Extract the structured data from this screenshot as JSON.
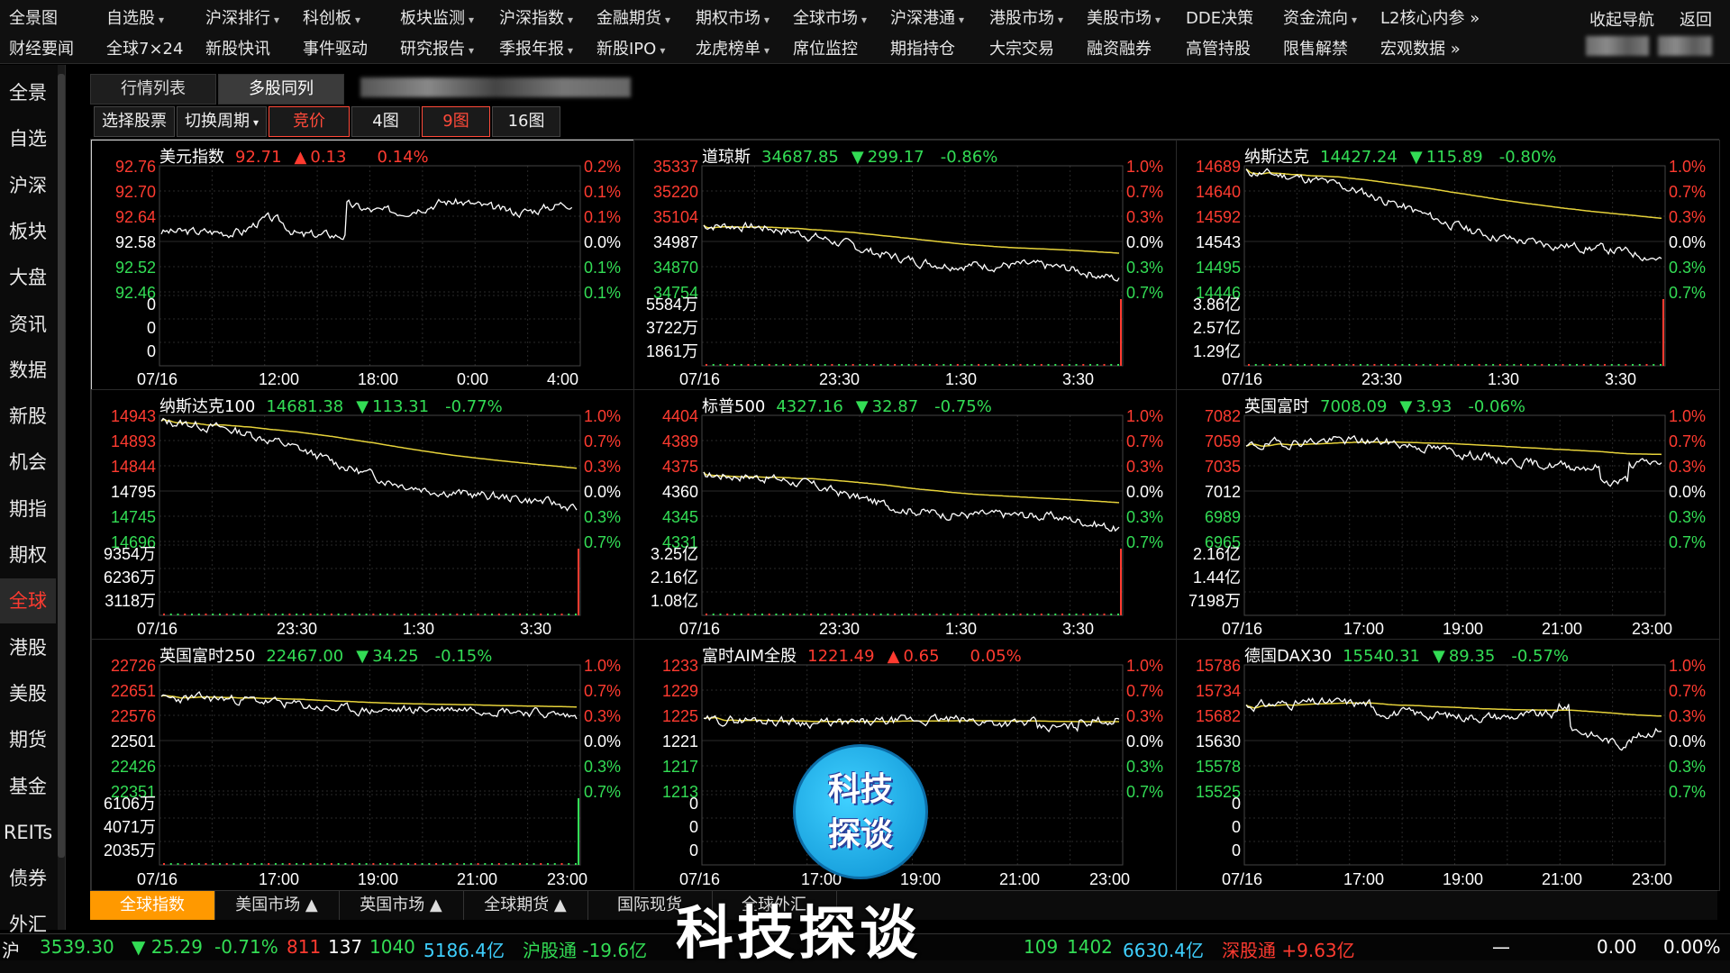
{
  "menu": {
    "row1": [
      {
        "label": "全景图",
        "caret": false
      },
      {
        "label": "自选股",
        "caret": true
      },
      {
        "label": "沪深排行",
        "caret": true
      },
      {
        "label": "科创板",
        "caret": true
      },
      {
        "label": "板块监测",
        "caret": true
      },
      {
        "label": "沪深指数",
        "caret": true
      },
      {
        "label": "金融期货",
        "caret": true
      },
      {
        "label": "期权市场",
        "caret": true
      },
      {
        "label": "全球市场",
        "caret": true
      },
      {
        "label": "沪深港通",
        "caret": true
      },
      {
        "label": "港股市场",
        "caret": true
      },
      {
        "label": "美股市场",
        "caret": true
      },
      {
        "label": "DDE决策",
        "caret": false
      },
      {
        "label": "资金流向",
        "caret": true
      },
      {
        "label": "L2核心内参 »",
        "caret": false
      }
    ],
    "row2": [
      {
        "label": "财经要闻",
        "caret": false
      },
      {
        "label": "全球7×24",
        "caret": false
      },
      {
        "label": "新股快讯",
        "caret": false
      },
      {
        "label": "事件驱动",
        "caret": false
      },
      {
        "label": "研究报告",
        "caret": true
      },
      {
        "label": "季报年报",
        "caret": true
      },
      {
        "label": "新股IPO",
        "caret": true
      },
      {
        "label": "龙虎榜单",
        "caret": true
      },
      {
        "label": "席位监控",
        "caret": false
      },
      {
        "label": "期指持仓",
        "caret": false
      },
      {
        "label": "大宗交易",
        "caret": false
      },
      {
        "label": "融资融券",
        "caret": false
      },
      {
        "label": "高管持股",
        "caret": false
      },
      {
        "label": "限售解禁",
        "caret": false
      },
      {
        "label": "宏观数据 »",
        "caret": true
      }
    ],
    "collapse_nav": "收起导航",
    "back": "返回"
  },
  "sidebar": [
    "全景",
    "自选",
    "沪深",
    "板块",
    "大盘",
    "资讯",
    "数据",
    "新股",
    "机会",
    "期指",
    "期权",
    "全球",
    "港股",
    "美股",
    "期货",
    "基金",
    "REITs",
    "债券",
    "外汇"
  ],
  "sidebar_active": 11,
  "tabs": [
    "行情列表",
    "多股同列"
  ],
  "tab_active": 1,
  "toolbar": {
    "select_stock": "选择股票",
    "switch_period": "切换周期",
    "bid": "竞价",
    "view4": "4图",
    "view9": "9图",
    "view16": "16图"
  },
  "panels": [
    {
      "name": "美元指数",
      "price": "92.71",
      "arrow": "▲",
      "change": "0.13",
      "pct": "0.14%",
      "up": true,
      "prices": [
        "92.76",
        "92.70",
        "92.64",
        "92.58",
        "92.52",
        "92.46"
      ],
      "pcts": [
        "0.2%",
        "0.1%",
        "0.1%",
        "0.0%",
        "0.1%",
        "0.1%"
      ],
      "vols": [
        "0",
        "0",
        "0"
      ],
      "times": [
        "07/16",
        "12:00",
        "18:00",
        "0:00",
        "4:00"
      ],
      "seed": 3,
      "trend": "up",
      "volbar": false
    },
    {
      "name": "道琼斯",
      "price": "34687.85",
      "arrow": "▼",
      "change": "299.17",
      "pct": "-0.86%",
      "up": false,
      "prices": [
        "35337",
        "35220",
        "35104",
        "34987",
        "34870",
        "34754"
      ],
      "pcts": [
        "1.0%",
        "0.7%",
        "0.3%",
        "0.0%",
        "0.3%",
        "0.7%"
      ],
      "vols": [
        "5584万",
        "3722万",
        "1861万"
      ],
      "times": [
        "07/16",
        "23:30",
        "1:30",
        "3:30"
      ],
      "seed": 7,
      "trend": "down",
      "volbar": true
    },
    {
      "name": "纳斯达克",
      "price": "14427.24",
      "arrow": "▼",
      "change": "115.89",
      "pct": "-0.80%",
      "up": false,
      "prices": [
        "14689",
        "14640",
        "14592",
        "14543",
        "14495",
        "14446"
      ],
      "pcts": [
        "1.0%",
        "0.7%",
        "0.3%",
        "0.0%",
        "0.3%",
        "0.7%"
      ],
      "vols": [
        "3.86亿",
        "2.57亿",
        "1.29亿"
      ],
      "times": [
        "07/16",
        "23:30",
        "1:30",
        "3:30"
      ],
      "seed": 11,
      "trend": "down2",
      "volbar": true
    },
    {
      "name": "纳斯达克100",
      "price": "14681.38",
      "arrow": "▼",
      "change": "113.31",
      "pct": "-0.77%",
      "up": false,
      "prices": [
        "14943",
        "14893",
        "14844",
        "14795",
        "14745",
        "14696"
      ],
      "pcts": [
        "1.0%",
        "0.7%",
        "0.3%",
        "0.0%",
        "0.3%",
        "0.7%"
      ],
      "vols": [
        "9354万",
        "6236万",
        "3118万"
      ],
      "times": [
        "07/16",
        "23:30",
        "1:30",
        "3:30"
      ],
      "seed": 13,
      "trend": "down2",
      "volbar": true
    },
    {
      "name": "标普500",
      "price": "4327.16",
      "arrow": "▼",
      "change": "32.87",
      "pct": "-0.75%",
      "up": false,
      "prices": [
        "4404",
        "4389",
        "4375",
        "4360",
        "4345",
        "4331"
      ],
      "pcts": [
        "1.0%",
        "0.7%",
        "0.3%",
        "0.0%",
        "0.3%",
        "0.7%"
      ],
      "vols": [
        "3.25亿",
        "2.16亿",
        "1.08亿"
      ],
      "times": [
        "07/16",
        "23:30",
        "1:30",
        "3:30"
      ],
      "seed": 17,
      "trend": "down",
      "volbar": true
    },
    {
      "name": "英国富时",
      "price": "7008.09",
      "arrow": "▼",
      "change": "3.93",
      "pct": "-0.06%",
      "up": false,
      "prices": [
        "7082",
        "7059",
        "7035",
        "7012",
        "6989",
        "6965"
      ],
      "pcts": [
        "1.0%",
        "0.7%",
        "0.3%",
        "0.0%",
        "0.3%",
        "0.7%"
      ],
      "vols": [
        "2.16亿",
        "1.44亿",
        "7198万"
      ],
      "times": [
        "07/16",
        "17:00",
        "19:00",
        "21:00",
        "23:00"
      ],
      "seed": 19,
      "trend": "flat",
      "volbar": false
    },
    {
      "name": "英国富时250",
      "price": "22467.00",
      "arrow": "▼",
      "change": "34.25",
      "pct": "-0.15%",
      "up": false,
      "prices": [
        "22726",
        "22651",
        "22576",
        "22501",
        "22426",
        "22351"
      ],
      "pcts": [
        "1.0%",
        "0.7%",
        "0.3%",
        "0.0%",
        "0.3%",
        "0.7%"
      ],
      "vols": [
        "6106万",
        "4071万",
        "2035万"
      ],
      "times": [
        "07/16",
        "17:00",
        "19:00",
        "21:00",
        "23:00"
      ],
      "seed": 23,
      "trend": "flatdown",
      "volbar": true
    },
    {
      "name": "富时AIM全股",
      "price": "1221.49",
      "arrow": "▲",
      "change": "0.65",
      "pct": "0.05%",
      "up": true,
      "prices": [
        "1233",
        "1229",
        "1225",
        "1221",
        "1217",
        "1213"
      ],
      "pcts": [
        "1.0%",
        "0.7%",
        "0.3%",
        "0.0%",
        "0.3%",
        "0.7%"
      ],
      "vols": [
        "0",
        "0",
        "0"
      ],
      "times": [
        "07/16",
        "17:00",
        "19:00",
        "21:00",
        "23:00"
      ],
      "seed": 29,
      "trend": "flatter",
      "volbar": false
    },
    {
      "name": "德国DAX30",
      "price": "15540.31",
      "arrow": "▼",
      "change": "89.35",
      "pct": "-0.57%",
      "up": false,
      "prices": [
        "15786",
        "15734",
        "15682",
        "15630",
        "15578",
        "15525"
      ],
      "pcts": [
        "1.0%",
        "0.7%",
        "0.3%",
        "0.0%",
        "0.3%",
        "0.7%"
      ],
      "vols": [
        "0",
        "0",
        "0"
      ],
      "times": [
        "07/16",
        "17:00",
        "19:00",
        "21:00",
        "23:00"
      ],
      "seed": 31,
      "trend": "dax",
      "volbar": false
    }
  ],
  "selected_panel": 0,
  "bottom_tabs": [
    {
      "label": "全球指数",
      "active": true
    },
    {
      "label": "美国市场 ▲",
      "active": false
    },
    {
      "label": "英国市场 ▲",
      "active": false
    },
    {
      "label": "全球期货 ▲",
      "active": false
    },
    {
      "label": "国际现货",
      "active": false
    },
    {
      "label": "全球外汇",
      "active": false
    }
  ],
  "status": {
    "sh_label": "沪",
    "sh_price": "3539.30",
    "sh_change": "▼ 25.29",
    "sh_pct": "-0.71%",
    "sh_up": "811",
    "sh_flat": "137",
    "sh_down": "1040",
    "sh_amount": "5186.4亿",
    "hgt": "沪股通 -19.6亿",
    "sz_down": "109",
    "sz_total": "1402",
    "sz_amount": "6630.4亿",
    "sgt": "深股通 +9.63亿",
    "right_dash": "—",
    "right_val": "0.00",
    "right_pct": "0.00%"
  },
  "watermark": {
    "logo_top": "科技",
    "logo_bottom": "探谈",
    "text": "科技探谈"
  },
  "colors": {
    "up": "#ff3b30",
    "down": "#33dd55",
    "price_line": "#ffffff",
    "avg_line": "#e6d23a",
    "grid": "#2a2a2a",
    "highlight": "#ff9900"
  }
}
